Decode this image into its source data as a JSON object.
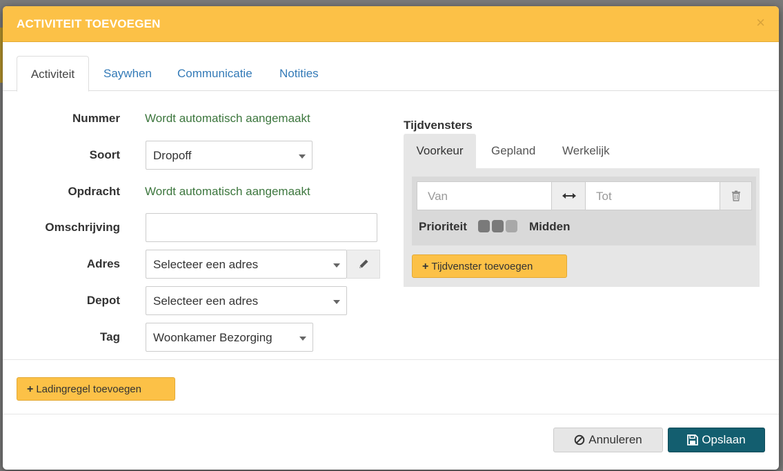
{
  "modal": {
    "title": "ACTIVITEIT TOEVOEGEN",
    "close_symbol": "×"
  },
  "tabs": [
    {
      "label": "Activiteit",
      "active": true
    },
    {
      "label": "Saywhen",
      "active": false
    },
    {
      "label": "Communicatie",
      "active": false
    },
    {
      "label": "Notities",
      "active": false
    }
  ],
  "form": {
    "nummer": {
      "label": "Nummer",
      "value": "Wordt automatisch aangemaakt"
    },
    "soort": {
      "label": "Soort",
      "value": "Dropoff"
    },
    "opdracht": {
      "label": "Opdracht",
      "value": "Wordt automatisch aangemaakt"
    },
    "omschrijving": {
      "label": "Omschrijving",
      "value": ""
    },
    "adres": {
      "label": "Adres",
      "value": "Selecteer een adres",
      "edit_icon": "pencil-icon"
    },
    "depot": {
      "label": "Depot",
      "value": "Selecteer een adres"
    },
    "tag": {
      "label": "Tag",
      "value": "Woonkamer Bezorging"
    }
  },
  "tijdvensters": {
    "heading": "Tijdvensters",
    "tabs": [
      {
        "label": "Voorkeur",
        "active": true
      },
      {
        "label": "Gepland",
        "active": false
      },
      {
        "label": "Werkelijk",
        "active": false
      }
    ],
    "van_placeholder": "Van",
    "tot_placeholder": "Tot",
    "range_icon": "double-arrow-icon",
    "delete_icon": "trash-icon",
    "prioriteit_label": "Prioriteit",
    "prioriteit_value": "Midden",
    "prioriteit_level": 2,
    "prioriteit_max": 3,
    "add_button": "Tijdvenster toevoegen"
  },
  "ladingregel_button": "Ladingregel toevoegen",
  "footer": {
    "cancel_label": "Annuleren",
    "cancel_icon": "ban-icon",
    "save_label": "Opslaan",
    "save_icon": "floppy-icon"
  },
  "colors": {
    "header": "#fcc147",
    "success_text": "#3c763d",
    "primary": "#135e6f",
    "link": "#337ab7"
  }
}
